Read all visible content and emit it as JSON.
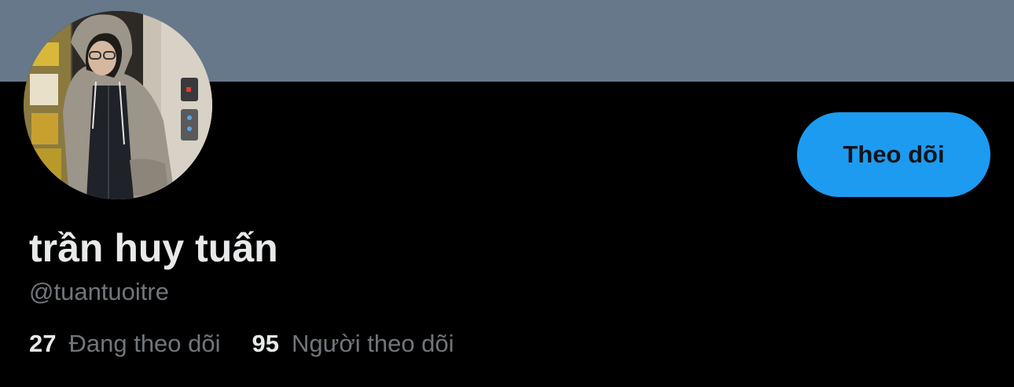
{
  "profile": {
    "display_name": "trần huy tuấn",
    "handle": "@tuantuoitre",
    "follow_button_label": "Theo dõi",
    "banner_color": "#66788a",
    "accent_color": "#1d9bf0",
    "avatar_icon": "profile-photo"
  },
  "stats": [
    {
      "count": "27",
      "label": "Đang theo dõi"
    },
    {
      "count": "95",
      "label": "Người theo dõi"
    }
  ]
}
